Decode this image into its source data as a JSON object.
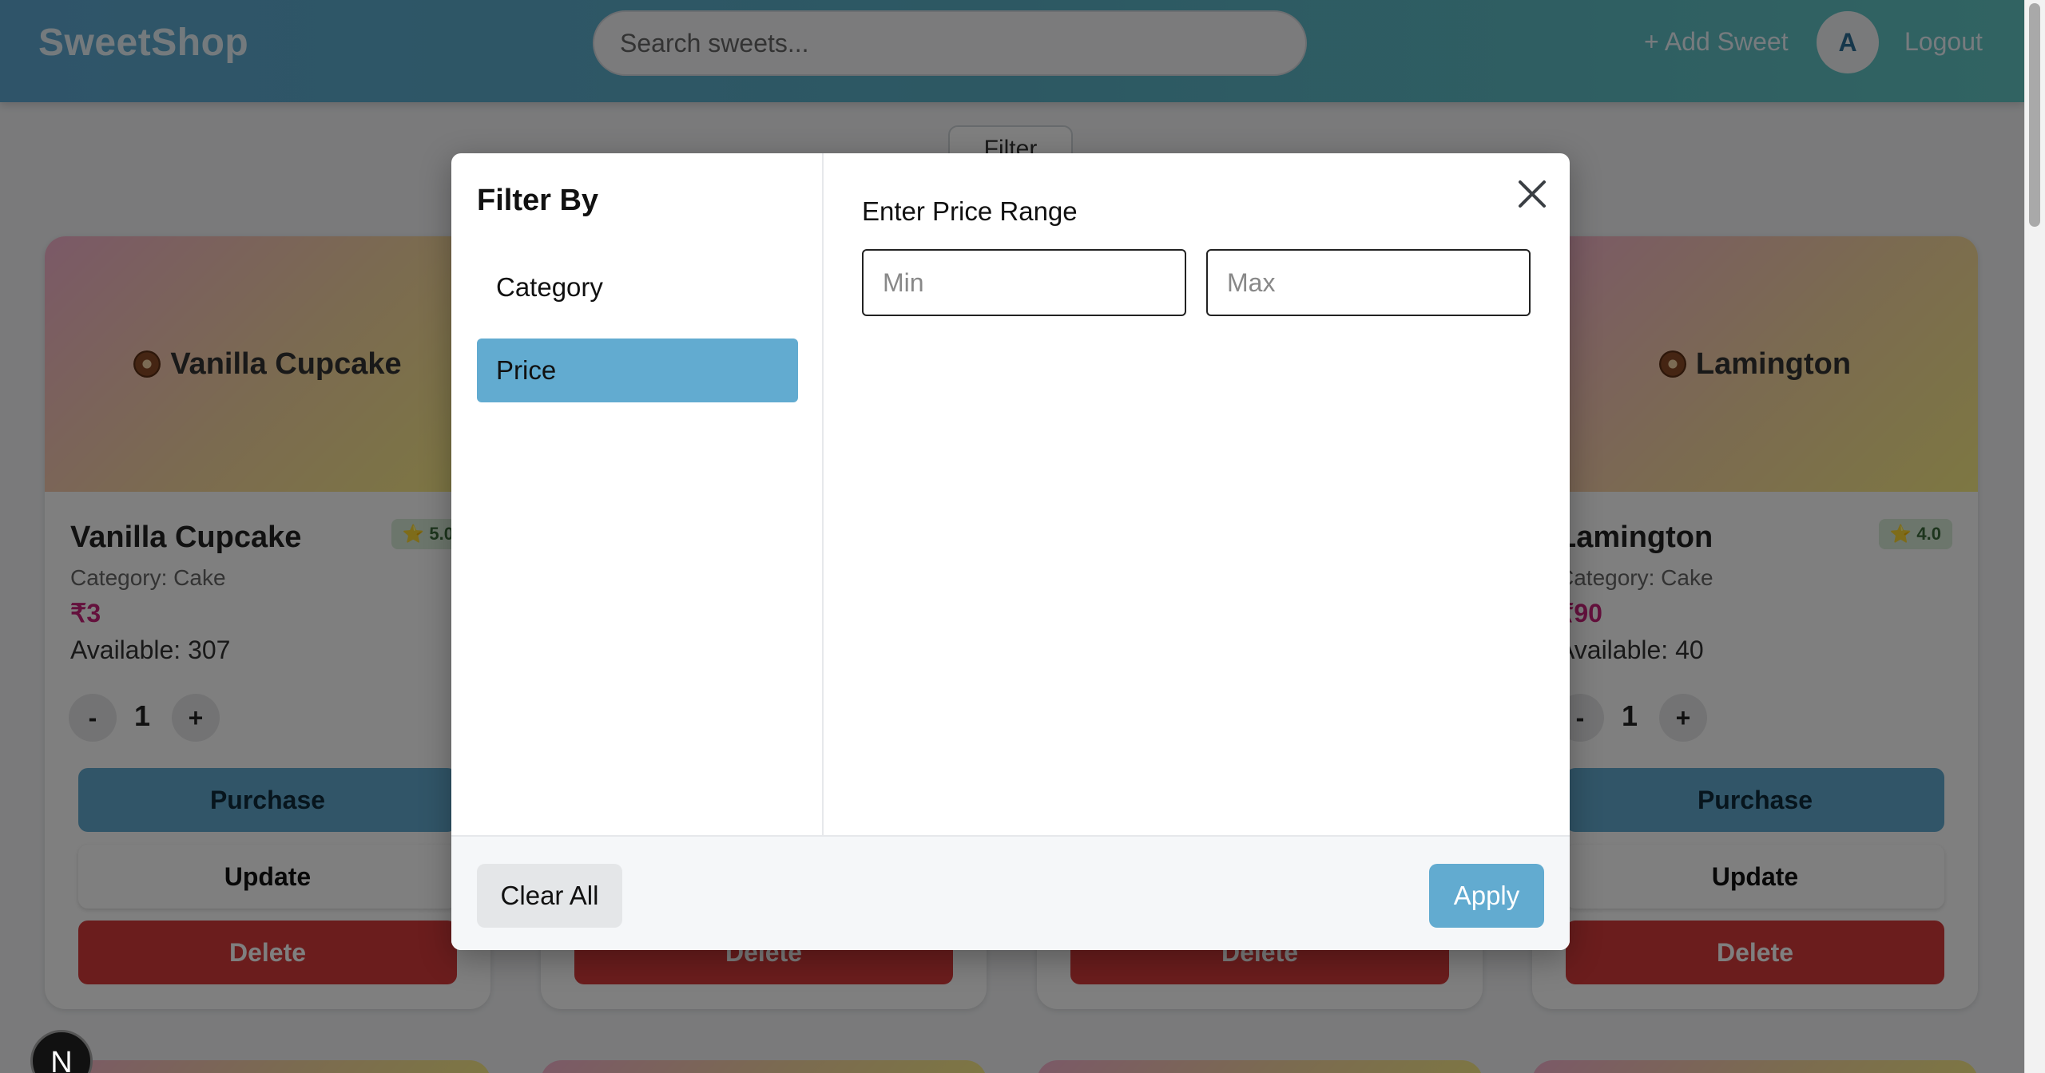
{
  "header": {
    "logo": "SweetShop",
    "search_placeholder": "Search sweets...",
    "add_sweet": "+ Add Sweet",
    "avatar_initial": "A",
    "logout": "Logout"
  },
  "filter_button": "Filter",
  "cards": [
    {
      "image_label": "Vanilla Cupcake",
      "name": "Vanilla Cupcake",
      "rating": "5.0",
      "category": "Category: Cake",
      "price": "₹3",
      "available": "Available: 307",
      "qty": "1"
    },
    {
      "image_label": "Lamington",
      "name": "Lamington",
      "rating": "4.0",
      "category": "Category: Cake",
      "price": "₹90",
      "available": "Available: 40",
      "qty": "1"
    }
  ],
  "card_buttons": {
    "minus": "-",
    "plus": "+",
    "purchase": "Purchase",
    "update": "Update",
    "delete": "Delete"
  },
  "modal": {
    "heading": "Filter By",
    "options": [
      "Category",
      "Price"
    ],
    "active_option": "Price",
    "main_label": "Enter Price Range",
    "min_placeholder": "Min",
    "max_placeholder": "Max",
    "clear_all": "Clear All",
    "apply": "Apply"
  },
  "next_badge": "N",
  "colors": {
    "accent": "#62abd0",
    "delete": "#d63a3a",
    "price": "#c9237a"
  }
}
